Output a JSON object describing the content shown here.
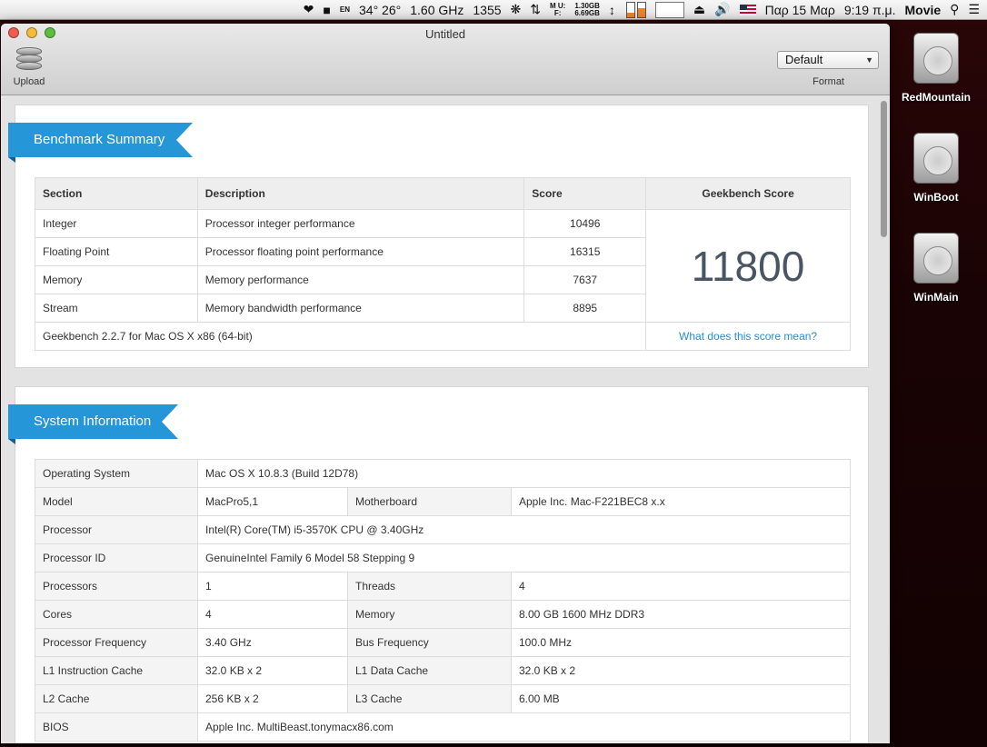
{
  "menubar": {
    "lang": "EN",
    "temps": "34° 26°",
    "cpu_freq": "1.60 GHz",
    "fan": "1355",
    "mem_u_label": "M U:",
    "mem_f_label": "F:",
    "mem_used": "1.30GB",
    "mem_free": "6.69GB",
    "date": "Παρ 15 Μαρ",
    "time": "9:19 π.μ.",
    "app": "Movie"
  },
  "window": {
    "title": "Untitled",
    "upload_label": "Upload",
    "format_value": "Default",
    "format_label": "Format"
  },
  "summary": {
    "heading": "Benchmark Summary",
    "headers": {
      "section": "Section",
      "description": "Description",
      "score": "Score",
      "geekbench": "Geekbench Score"
    },
    "rows": [
      {
        "section": "Integer",
        "description": "Processor integer performance",
        "score": "10496"
      },
      {
        "section": "Floating Point",
        "description": "Processor floating point performance",
        "score": "16315"
      },
      {
        "section": "Memory",
        "description": "Memory performance",
        "score": "7637"
      },
      {
        "section": "Stream",
        "description": "Memory bandwidth performance",
        "score": "8895"
      }
    ],
    "total_score": "11800",
    "version": "Geekbench 2.2.7 for Mac OS X x86 (64-bit)",
    "score_link": "What does this score mean?"
  },
  "sysinfo": {
    "heading": "System Information",
    "os_label": "Operating System",
    "os_value": "Mac OS X 10.8.3 (Build 12D78)",
    "model_label": "Model",
    "model_value": "MacPro5,1",
    "motherboard_label": "Motherboard",
    "motherboard_value": "Apple Inc. Mac-F221BEC8 x.x",
    "processor_label": "Processor",
    "processor_value": "Intel(R) Core(TM) i5-3570K CPU @ 3.40GHz",
    "processor_id_label": "Processor ID",
    "processor_id_value": "GenuineIntel Family 6 Model 58 Stepping 9",
    "processors_label": "Processors",
    "processors_value": "1",
    "threads_label": "Threads",
    "threads_value": "4",
    "cores_label": "Cores",
    "cores_value": "4",
    "memory_label": "Memory",
    "memory_value": "8.00 GB 1600 MHz DDR3",
    "freq_label": "Processor Frequency",
    "freq_value": "3.40 GHz",
    "bus_label": "Bus Frequency",
    "bus_value": "100.0 MHz",
    "l1i_label": "L1 Instruction Cache",
    "l1i_value": "32.0 KB x 2",
    "l1d_label": "L1 Data Cache",
    "l1d_value": "32.0 KB x 2",
    "l2_label": "L2 Cache",
    "l2_value": "256 KB x 2",
    "l3_label": "L3 Cache",
    "l3_value": "6.00 MB",
    "bios_label": "BIOS",
    "bios_value": "Apple Inc. MultiBeast.tonymacx86.com"
  },
  "desktop": {
    "drives": [
      "RedMountain",
      "WinBoot",
      "WinMain"
    ]
  }
}
